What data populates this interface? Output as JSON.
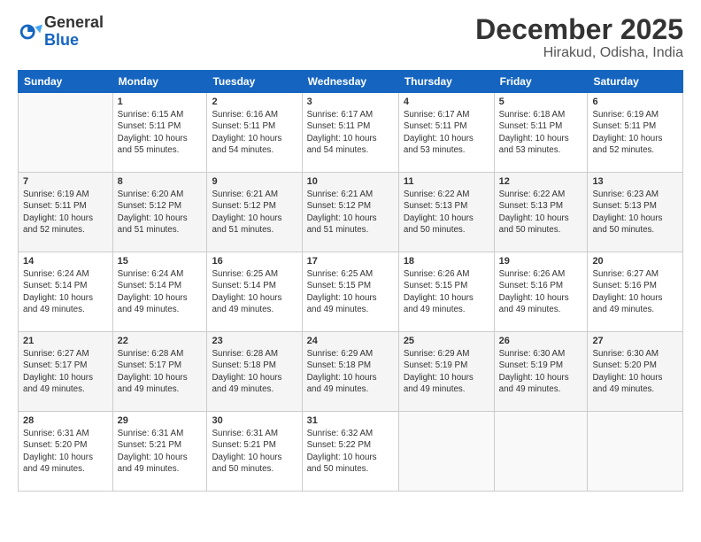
{
  "logo": {
    "text_general": "General",
    "text_blue": "Blue"
  },
  "header": {
    "month": "December 2025",
    "location": "Hirakud, Odisha, India"
  },
  "days_of_week": [
    "Sunday",
    "Monday",
    "Tuesday",
    "Wednesday",
    "Thursday",
    "Friday",
    "Saturday"
  ],
  "weeks": [
    [
      {
        "day": "",
        "info": ""
      },
      {
        "day": "1",
        "info": "Sunrise: 6:15 AM\nSunset: 5:11 PM\nDaylight: 10 hours\nand 55 minutes."
      },
      {
        "day": "2",
        "info": "Sunrise: 6:16 AM\nSunset: 5:11 PM\nDaylight: 10 hours\nand 54 minutes."
      },
      {
        "day": "3",
        "info": "Sunrise: 6:17 AM\nSunset: 5:11 PM\nDaylight: 10 hours\nand 54 minutes."
      },
      {
        "day": "4",
        "info": "Sunrise: 6:17 AM\nSunset: 5:11 PM\nDaylight: 10 hours\nand 53 minutes."
      },
      {
        "day": "5",
        "info": "Sunrise: 6:18 AM\nSunset: 5:11 PM\nDaylight: 10 hours\nand 53 minutes."
      },
      {
        "day": "6",
        "info": "Sunrise: 6:19 AM\nSunset: 5:11 PM\nDaylight: 10 hours\nand 52 minutes."
      }
    ],
    [
      {
        "day": "7",
        "info": "Sunrise: 6:19 AM\nSunset: 5:11 PM\nDaylight: 10 hours\nand 52 minutes."
      },
      {
        "day": "8",
        "info": "Sunrise: 6:20 AM\nSunset: 5:12 PM\nDaylight: 10 hours\nand 51 minutes."
      },
      {
        "day": "9",
        "info": "Sunrise: 6:21 AM\nSunset: 5:12 PM\nDaylight: 10 hours\nand 51 minutes."
      },
      {
        "day": "10",
        "info": "Sunrise: 6:21 AM\nSunset: 5:12 PM\nDaylight: 10 hours\nand 51 minutes."
      },
      {
        "day": "11",
        "info": "Sunrise: 6:22 AM\nSunset: 5:13 PM\nDaylight: 10 hours\nand 50 minutes."
      },
      {
        "day": "12",
        "info": "Sunrise: 6:22 AM\nSunset: 5:13 PM\nDaylight: 10 hours\nand 50 minutes."
      },
      {
        "day": "13",
        "info": "Sunrise: 6:23 AM\nSunset: 5:13 PM\nDaylight: 10 hours\nand 50 minutes."
      }
    ],
    [
      {
        "day": "14",
        "info": "Sunrise: 6:24 AM\nSunset: 5:14 PM\nDaylight: 10 hours\nand 49 minutes."
      },
      {
        "day": "15",
        "info": "Sunrise: 6:24 AM\nSunset: 5:14 PM\nDaylight: 10 hours\nand 49 minutes."
      },
      {
        "day": "16",
        "info": "Sunrise: 6:25 AM\nSunset: 5:14 PM\nDaylight: 10 hours\nand 49 minutes."
      },
      {
        "day": "17",
        "info": "Sunrise: 6:25 AM\nSunset: 5:15 PM\nDaylight: 10 hours\nand 49 minutes."
      },
      {
        "day": "18",
        "info": "Sunrise: 6:26 AM\nSunset: 5:15 PM\nDaylight: 10 hours\nand 49 minutes."
      },
      {
        "day": "19",
        "info": "Sunrise: 6:26 AM\nSunset: 5:16 PM\nDaylight: 10 hours\nand 49 minutes."
      },
      {
        "day": "20",
        "info": "Sunrise: 6:27 AM\nSunset: 5:16 PM\nDaylight: 10 hours\nand 49 minutes."
      }
    ],
    [
      {
        "day": "21",
        "info": "Sunrise: 6:27 AM\nSunset: 5:17 PM\nDaylight: 10 hours\nand 49 minutes."
      },
      {
        "day": "22",
        "info": "Sunrise: 6:28 AM\nSunset: 5:17 PM\nDaylight: 10 hours\nand 49 minutes."
      },
      {
        "day": "23",
        "info": "Sunrise: 6:28 AM\nSunset: 5:18 PM\nDaylight: 10 hours\nand 49 minutes."
      },
      {
        "day": "24",
        "info": "Sunrise: 6:29 AM\nSunset: 5:18 PM\nDaylight: 10 hours\nand 49 minutes."
      },
      {
        "day": "25",
        "info": "Sunrise: 6:29 AM\nSunset: 5:19 PM\nDaylight: 10 hours\nand 49 minutes."
      },
      {
        "day": "26",
        "info": "Sunrise: 6:30 AM\nSunset: 5:19 PM\nDaylight: 10 hours\nand 49 minutes."
      },
      {
        "day": "27",
        "info": "Sunrise: 6:30 AM\nSunset: 5:20 PM\nDaylight: 10 hours\nand 49 minutes."
      }
    ],
    [
      {
        "day": "28",
        "info": "Sunrise: 6:31 AM\nSunset: 5:20 PM\nDaylight: 10 hours\nand 49 minutes."
      },
      {
        "day": "29",
        "info": "Sunrise: 6:31 AM\nSunset: 5:21 PM\nDaylight: 10 hours\nand 49 minutes."
      },
      {
        "day": "30",
        "info": "Sunrise: 6:31 AM\nSunset: 5:21 PM\nDaylight: 10 hours\nand 50 minutes."
      },
      {
        "day": "31",
        "info": "Sunrise: 6:32 AM\nSunset: 5:22 PM\nDaylight: 10 hours\nand 50 minutes."
      },
      {
        "day": "",
        "info": ""
      },
      {
        "day": "",
        "info": ""
      },
      {
        "day": "",
        "info": ""
      }
    ]
  ]
}
